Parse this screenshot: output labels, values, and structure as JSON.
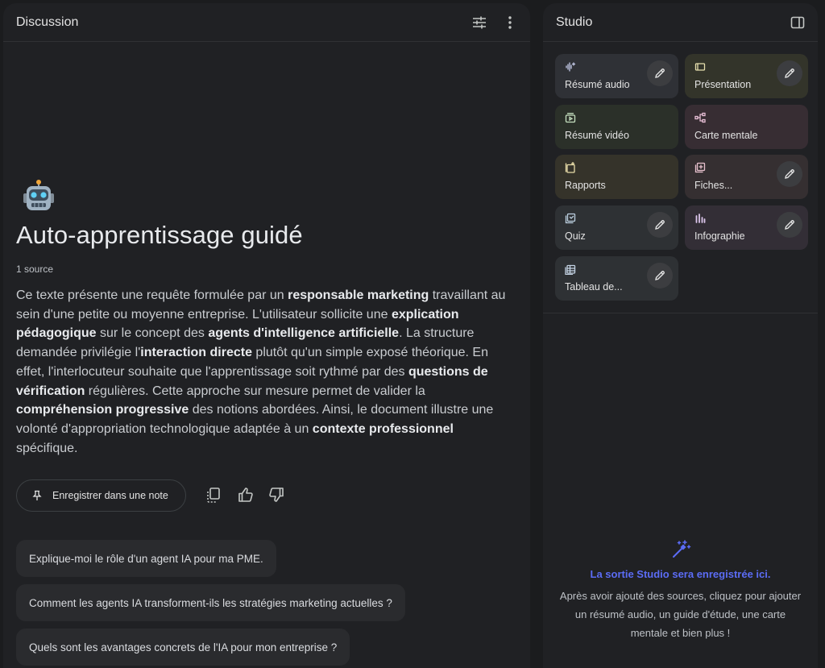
{
  "discussion": {
    "title": "Discussion",
    "notebook_emoji": "🤖",
    "notebook_title": "Auto-apprentissage guidé",
    "source_count": "1 source",
    "summary_segments": [
      {
        "t": "Ce texte présente une requête formulée par un ",
        "b": false
      },
      {
        "t": "responsable marketing",
        "b": true
      },
      {
        "t": " travaillant au sein d'une petite ou moyenne entreprise. L'utilisateur sollicite une ",
        "b": false
      },
      {
        "t": "explication pédagogique",
        "b": true
      },
      {
        "t": " sur le concept des ",
        "b": false
      },
      {
        "t": "agents d'intelligence artificielle",
        "b": true
      },
      {
        "t": ". La structure demandée privilégie l'",
        "b": false
      },
      {
        "t": "interaction directe",
        "b": true
      },
      {
        "t": " plutôt qu'un simple exposé théorique. En effet, l'interlocuteur souhaite que l'apprentissage soit rythmé par des ",
        "b": false
      },
      {
        "t": "questions de vérification",
        "b": true
      },
      {
        "t": " régulières. Cette approche sur mesure permet de valider la ",
        "b": false
      },
      {
        "t": "compréhension progressive",
        "b": true
      },
      {
        "t": " des notions abordées. Ainsi, le document illustre une volonté d'appropriation technologique adaptée à un ",
        "b": false
      },
      {
        "t": "contexte professionnel",
        "b": true
      },
      {
        "t": " spécifique.",
        "b": false
      }
    ],
    "save_note_label": "Enregistrer dans une note",
    "suggestions": [
      "Explique-moi le rôle d'un agent IA pour ma PME.",
      "Comment les agents IA transforment-ils les stratégies marketing actuelles ?",
      "Quels sont les avantages concrets de l'IA pour mon entreprise ?"
    ]
  },
  "studio": {
    "title": "Studio",
    "tiles": [
      {
        "label": "Résumé audio",
        "icon": "audio-waveform-icon",
        "bg": "#2f3136",
        "color": "#c5cbe9",
        "editable": true
      },
      {
        "label": "Présentation",
        "icon": "slides-icon",
        "bg": "#33342a",
        "color": "#e6dfae",
        "editable": true
      },
      {
        "label": "Résumé vidéo",
        "icon": "video-icon",
        "bg": "#2b3029",
        "color": "#c6e0c0",
        "editable": false
      },
      {
        "label": "Carte mentale",
        "icon": "mind-map-icon",
        "bg": "#372d33",
        "color": "#e8bfd6",
        "editable": false
      },
      {
        "label": "Rapports",
        "icon": "reports-icon",
        "bg": "#35332a",
        "color": "#e8dca8",
        "editable": false
      },
      {
        "label": "Fiches...",
        "icon": "flashcards-icon",
        "bg": "#352f31",
        "color": "#e9c2cf",
        "editable": true
      },
      {
        "label": "Quiz",
        "icon": "quiz-icon",
        "bg": "#2e3134",
        "color": "#bcd0e0",
        "editable": true
      },
      {
        "label": "Infographie",
        "icon": "infographic-icon",
        "bg": "#332e36",
        "color": "#dcc6ec",
        "editable": true
      },
      {
        "label": "Tableau de...",
        "icon": "table-icon",
        "bg": "#2e3134",
        "color": "#c4d3e4",
        "editable": true
      }
    ],
    "empty_title": "La sortie Studio sera enregistrée ici.",
    "empty_desc": "Après avoir ajouté des sources, cliquez pour ajouter un résumé audio, un guide d'étude, une carte mentale et bien plus !",
    "accent": "#5b6cf5"
  }
}
